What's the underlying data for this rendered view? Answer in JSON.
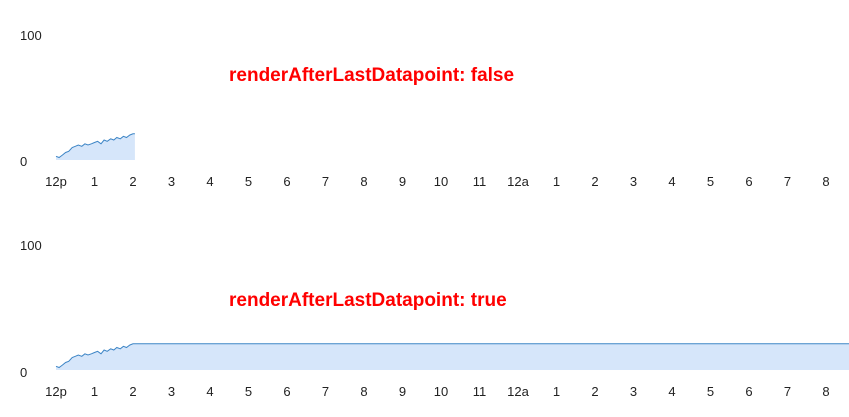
{
  "colors": {
    "line": "#3d85c6",
    "fill": "#d6e6fa",
    "annotation": "#ff0000",
    "text": "#222222"
  },
  "chart_data": [
    {
      "type": "area",
      "annotation": "renderAfterLastDatapoint: false",
      "ylim": [
        0,
        100
      ],
      "y_ticks": [
        "100",
        "0"
      ],
      "x_ticks": [
        "12p",
        "1",
        "2",
        "3",
        "4",
        "5",
        "6",
        "7",
        "8",
        "9",
        "10",
        "11",
        "12a",
        "1",
        "2",
        "3",
        "4",
        "5",
        "6",
        "7",
        "8"
      ],
      "render_after_last_datapoint": false,
      "series": [
        {
          "x_hours": [
            0.0,
            0.08,
            0.17,
            0.25,
            0.33,
            0.42,
            0.5,
            0.58,
            0.67,
            0.75,
            0.83,
            0.92,
            1.0,
            1.08,
            1.17,
            1.25,
            1.33,
            1.42,
            1.5,
            1.58,
            1.67,
            1.75,
            1.83,
            1.92,
            2.0,
            2.05
          ],
          "values": [
            3,
            2,
            4,
            6,
            7,
            10,
            11,
            12,
            11,
            13,
            12,
            13,
            14,
            15,
            13,
            16,
            15,
            17,
            16,
            18,
            17,
            19,
            18,
            20,
            21,
            21
          ]
        }
      ]
    },
    {
      "type": "area",
      "annotation": "renderAfterLastDatapoint: true",
      "ylim": [
        0,
        100
      ],
      "y_ticks": [
        "100",
        "0"
      ],
      "x_ticks": [
        "12p",
        "1",
        "2",
        "3",
        "4",
        "5",
        "6",
        "7",
        "8",
        "9",
        "10",
        "11",
        "12a",
        "1",
        "2",
        "3",
        "4",
        "5",
        "6",
        "7",
        "8"
      ],
      "render_after_last_datapoint": true,
      "series": [
        {
          "x_hours": [
            0.0,
            0.08,
            0.17,
            0.25,
            0.33,
            0.42,
            0.5,
            0.58,
            0.67,
            0.75,
            0.83,
            0.92,
            1.0,
            1.08,
            1.17,
            1.25,
            1.33,
            1.42,
            1.5,
            1.58,
            1.67,
            1.75,
            1.83,
            1.92,
            2.0,
            2.05
          ],
          "values": [
            3,
            2,
            4,
            6,
            7,
            10,
            11,
            12,
            11,
            13,
            12,
            13,
            14,
            15,
            13,
            16,
            15,
            17,
            16,
            18,
            17,
            19,
            18,
            20,
            21,
            21
          ]
        }
      ]
    }
  ]
}
